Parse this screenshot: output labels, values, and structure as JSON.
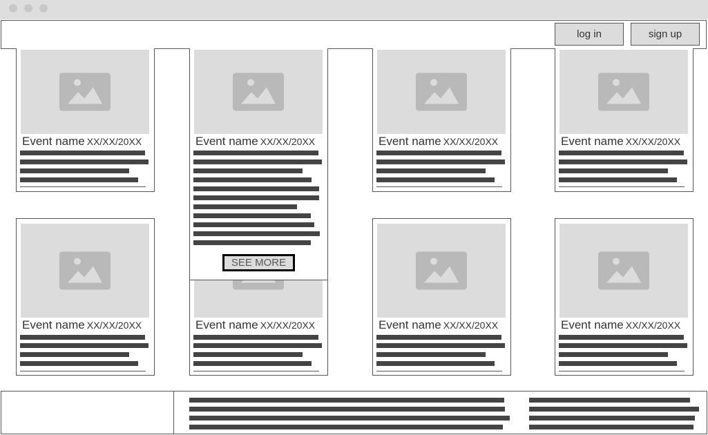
{
  "window": {
    "controls": [
      "close",
      "minimize",
      "maximize"
    ]
  },
  "header": {
    "login_label": "log in",
    "signup_label": "sign up"
  },
  "events": [
    {
      "name": "Event name",
      "date": "XX/XX/20XX",
      "icon": "image-placeholder-icon"
    },
    {
      "name": "Event name",
      "date": "XX/XX/20XX",
      "icon": "image-placeholder-icon",
      "expanded": true,
      "see_more_label": "SEE MORE"
    },
    {
      "name": "Event name",
      "date": "XX/XX/20XX",
      "icon": "image-placeholder-icon"
    },
    {
      "name": "Event name",
      "date": "XX/XX/20XX",
      "icon": "image-placeholder-icon"
    },
    {
      "name": "Event name",
      "date": "XX/XX/20XX",
      "icon": "image-placeholder-icon"
    },
    {
      "name": "Event name",
      "date": "XX/XX/20XX",
      "icon": "image-placeholder-icon"
    },
    {
      "name": "Event name",
      "date": "XX/XX/20XX",
      "icon": "image-placeholder-icon"
    },
    {
      "name": "Event name",
      "date": "XX/XX/20XX",
      "icon": "image-placeholder-icon"
    }
  ],
  "colors": {
    "placeholder_bg": "#dcdcdc",
    "placeholder_icon": "#b9b9b9",
    "text_line": "#444444",
    "border": "#555555"
  }
}
